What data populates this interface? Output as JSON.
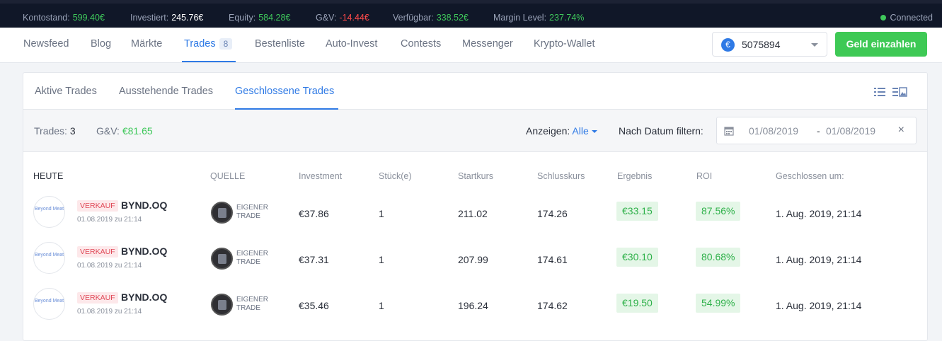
{
  "stats": [
    {
      "label": "Kontostand:",
      "value": "599.40€",
      "tone": "green"
    },
    {
      "label": "Investiert:",
      "value": "245.76€",
      "tone": "white"
    },
    {
      "label": "Equity:",
      "value": "584.28€",
      "tone": "green"
    },
    {
      "label": "G&V:",
      "value": "-14.44€",
      "tone": "red"
    },
    {
      "label": "Verfügbar:",
      "value": "338.52€",
      "tone": "green"
    },
    {
      "label": "Margin Level:",
      "value": "237.74%",
      "tone": "green"
    }
  ],
  "connection": "Connected",
  "nav": {
    "items": [
      "Newsfeed",
      "Blog",
      "Märkte",
      "Trades",
      "Bestenliste",
      "Auto-Invest",
      "Contests",
      "Messenger",
      "Krypto-Wallet"
    ],
    "active": "Trades",
    "trades_badge": "8"
  },
  "account": {
    "currency_symbol": "€",
    "number": "5075894"
  },
  "deposit_label": "Geld einzahlen",
  "tabs": {
    "items": [
      "Aktive Trades",
      "Ausstehende Trades",
      "Geschlossene Trades"
    ],
    "active": "Geschlossene Trades"
  },
  "summary": {
    "trades_label": "Trades:",
    "trades_value": "3",
    "pl_label": "G&V:",
    "pl_value": "€81.65"
  },
  "filter": {
    "show_label": "Anzeigen:",
    "show_value": "Alle",
    "date_label": "Nach Datum filtern:",
    "from": "01/08/2019",
    "separator": "-",
    "to": "01/08/2019",
    "clear": "×"
  },
  "columns": [
    "HEUTE",
    "QUELLE",
    "Investment",
    "Stück(e)",
    "Startkurs",
    "Schlusskurs",
    "Ergebnis",
    "ROI",
    "Geschlossen um:"
  ],
  "rows": [
    {
      "logo": "Beyond Meat",
      "side": "VERKAUF",
      "symbol": "BYND.OQ",
      "opened": "01.08.2019 zu 21:14",
      "source": [
        "EIGENER",
        "TRADE"
      ],
      "investment": "€37.86",
      "qty": "1",
      "start": "211.02",
      "close": "174.26",
      "result": "€33.15",
      "roi": "87.56%",
      "closed_at": "1. Aug. 2019, 21:14"
    },
    {
      "logo": "Beyond Meat",
      "side": "VERKAUF",
      "symbol": "BYND.OQ",
      "opened": "01.08.2019 zu 21:14",
      "source": [
        "EIGENER",
        "TRADE"
      ],
      "investment": "€37.31",
      "qty": "1",
      "start": "207.99",
      "close": "174.61",
      "result": "€30.10",
      "roi": "80.68%",
      "closed_at": "1. Aug. 2019, 21:14"
    },
    {
      "logo": "Beyond Meat",
      "side": "VERKAUF",
      "symbol": "BYND.OQ",
      "opened": "01.08.2019 zu 21:14",
      "source": [
        "EIGENER",
        "TRADE"
      ],
      "investment": "€35.46",
      "qty": "1",
      "start": "196.24",
      "close": "174.62",
      "result": "€19.50",
      "roi": "54.99%",
      "closed_at": "1. Aug. 2019, 21:14"
    }
  ],
  "colors": {
    "accent": "#2f7ae5",
    "positive": "#3ec955",
    "negative": "#ff4a4a",
    "topbar": "#101728"
  }
}
